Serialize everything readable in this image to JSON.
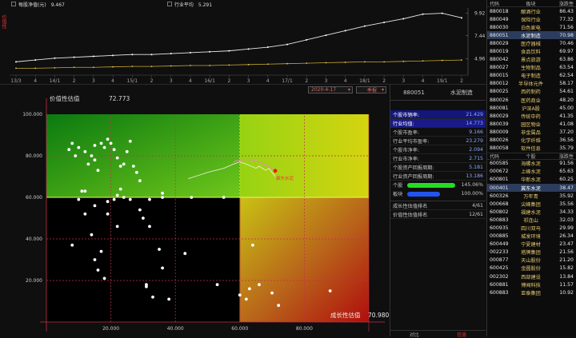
{
  "top_chart": {
    "series1_label": "每股净值(元)",
    "series1_value": "9.467",
    "series2_label": "行业平均",
    "series2_value": "5.291",
    "side_label": "价值性",
    "right_ticks": [
      "9.92",
      "7.44",
      "4.96"
    ],
    "x_labels": [
      "13/3",
      "4",
      "14/1",
      "2",
      "3",
      "4",
      "15/1",
      "2",
      "3",
      "4",
      "16/1",
      "2",
      "3",
      "4",
      "17/1",
      "2",
      "3",
      "4",
      "18/1",
      "2",
      "3",
      "4",
      "19/1",
      "2"
    ],
    "line1": [
      4.6,
      4.8,
      5.0,
      5.1,
      5.2,
      5.3,
      5.4,
      5.4,
      5.5,
      5.6,
      5.7,
      5.8,
      6.0,
      6.2,
      6.5,
      7.0,
      7.5,
      8.0,
      8.5,
      8.9,
      9.3,
      9.8,
      9.9,
      9.4
    ],
    "line2": [
      3.9,
      3.9,
      3.95,
      4.0,
      4.0,
      4.05,
      4.1,
      4.1,
      4.15,
      4.2,
      4.2,
      4.25,
      4.3,
      4.35,
      4.4,
      4.45,
      4.5,
      4.55,
      4.6,
      4.6,
      4.65,
      4.7,
      4.75,
      4.8
    ]
  },
  "controls": {
    "date": "2020-4-17",
    "period": "季报"
  },
  "scatter": {
    "y_title": "价值性估值",
    "y_title_value": "72.773",
    "x_title": "成长性估值",
    "x_title_value": "70.980",
    "y_ticks": [
      "100.000",
      "80.000",
      "60.000",
      "40.000",
      "20.000"
    ],
    "x_ticks": [
      "20.000",
      "40.000",
      "60.000",
      "80.000"
    ],
    "current_label": "冀东水泥",
    "points": [
      [
        7,
        83
      ],
      [
        8,
        86
      ],
      [
        9,
        80
      ],
      [
        10,
        84
      ],
      [
        12,
        82
      ],
      [
        13,
        76
      ],
      [
        14,
        80
      ],
      [
        15,
        78
      ],
      [
        15,
        85
      ],
      [
        16,
        73
      ],
      [
        17,
        86
      ],
      [
        18,
        84
      ],
      [
        19,
        88
      ],
      [
        20,
        86
      ],
      [
        21,
        83
      ],
      [
        22,
        79
      ],
      [
        23,
        75
      ],
      [
        24,
        76
      ],
      [
        25,
        82
      ],
      [
        26,
        87
      ],
      [
        27,
        75
      ],
      [
        28,
        72
      ],
      [
        29,
        68
      ],
      [
        23,
        64
      ],
      [
        22,
        61
      ],
      [
        24,
        60
      ],
      [
        11,
        63
      ],
      [
        12,
        63
      ],
      [
        10,
        59
      ],
      [
        12,
        52
      ],
      [
        15,
        56
      ],
      [
        19,
        58
      ],
      [
        21,
        59
      ],
      [
        19,
        52
      ],
      [
        22,
        46
      ],
      [
        26,
        59
      ],
      [
        29,
        54
      ],
      [
        30,
        50
      ],
      [
        32,
        59
      ],
      [
        36,
        60
      ],
      [
        36,
        62
      ],
      [
        45,
        60
      ],
      [
        32,
        46
      ],
      [
        35,
        35
      ],
      [
        36,
        26
      ],
      [
        31,
        18
      ],
      [
        31,
        17
      ],
      [
        33,
        12
      ],
      [
        38,
        11
      ],
      [
        43,
        33
      ],
      [
        8,
        37
      ],
      [
        14,
        42
      ],
      [
        15,
        30
      ],
      [
        16,
        25
      ],
      [
        17,
        34
      ],
      [
        18,
        21
      ],
      [
        55,
        60
      ],
      [
        53,
        18
      ],
      [
        62,
        11
      ],
      [
        63,
        16
      ],
      [
        64,
        37
      ],
      [
        66,
        18
      ],
      [
        70,
        14
      ],
      [
        72,
        8
      ],
      [
        88,
        15
      ],
      [
        60,
        13
      ]
    ],
    "trail": [
      [
        44,
        69
      ],
      [
        50,
        72
      ],
      [
        55,
        74
      ],
      [
        58,
        76
      ],
      [
        60,
        77
      ],
      [
        62,
        76
      ],
      [
        65,
        74
      ],
      [
        66,
        75
      ],
      [
        68,
        73
      ],
      [
        69,
        74
      ],
      [
        70,
        72
      ],
      [
        71,
        70
      ]
    ],
    "current_point": [
      70.98,
      72.773
    ]
  },
  "mid": {
    "header_code": "880051",
    "header_name": "水泥制造",
    "rows": [
      {
        "label": "个股市销率:",
        "value": "21.429",
        "hl": true
      },
      {
        "label": "行业均值:",
        "value": "14.773",
        "hl": true
      },
      {
        "label": "个股市盈率:",
        "value": "9.166",
        "hl": false
      },
      {
        "label": "行业平均市盈率:",
        "value": "23.279",
        "hl": false
      },
      {
        "label": "个股市净率:",
        "value": "2.094",
        "hl": false
      },
      {
        "label": "行业市净率:",
        "value": "2.715",
        "hl": false
      },
      {
        "label": "个股资产回报周期:",
        "value": "5.181",
        "hl": false
      },
      {
        "label": "行业资产回报周期:",
        "value": "13.186",
        "hl": false
      }
    ],
    "bars": [
      {
        "label": "个股",
        "value": "145.06%",
        "color": "#22dd22",
        "fill": 1.0
      },
      {
        "label": "板块",
        "value": "100.00%",
        "color": "#2255ee",
        "fill": 0.69
      }
    ],
    "rank_rows": [
      {
        "label": "成长性估值排名",
        "value": "4/61"
      },
      {
        "label": "价值性估值排名",
        "value": "12/61"
      }
    ],
    "bottom_tabs": [
      "对比",
      "信息"
    ]
  },
  "right": {
    "head": [
      "代码",
      "板块",
      "涨跌性"
    ],
    "sectors": [
      [
        "880018",
        "酿酒行业",
        "86.43"
      ],
      [
        "880049",
        "保险行业",
        "77.32"
      ],
      [
        "880030",
        "白色家电",
        "71.56"
      ],
      [
        "880051",
        "水泥制造",
        "70.98"
      ],
      [
        "880029",
        "医疗器械",
        "70.46"
      ],
      [
        "880019",
        "食品饮料",
        "69.97"
      ],
      [
        "880042",
        "景点旅游",
        "63.86"
      ],
      [
        "880027",
        "生物制品",
        "63.54"
      ],
      [
        "880015",
        "电子制造",
        "62.54"
      ],
      [
        "880012",
        "半导体元件",
        "58.17"
      ],
      [
        "880025",
        "西药制药",
        "54.61"
      ],
      [
        "880026",
        "医药商业",
        "48.20"
      ],
      [
        "880081",
        "沪深A股",
        "45.00"
      ],
      [
        "880029",
        "传统中药",
        "41.35"
      ],
      [
        "880039",
        "园区物业",
        "41.08"
      ],
      [
        "880009",
        "非金属品",
        "37.20"
      ],
      [
        "880026",
        "化学纤维",
        "36.56"
      ],
      [
        "880058",
        "软件信息",
        "35.79"
      ]
    ],
    "head2": [
      "代码",
      "个股",
      "涨跌性"
    ],
    "stocks": [
      [
        "600585",
        "海螺水泥",
        "91.56"
      ],
      [
        "000672",
        "上峰水泥",
        "65.63"
      ],
      [
        "600801",
        "华新水泥",
        "60.25"
      ],
      [
        "000401",
        "冀东水泥",
        "38.47"
      ],
      [
        "600326",
        "万年青",
        "35.92"
      ],
      [
        "000668",
        "尖峰集团",
        "35.56"
      ],
      [
        "600802",
        "福建水泥",
        "34.33"
      ],
      [
        "600883",
        "祁连山",
        "32.03"
      ],
      [
        "600935",
        "四川双马",
        "29.99"
      ],
      [
        "000885",
        "城发环境",
        "26.34"
      ],
      [
        "600449",
        "宁夏建材",
        "23.47"
      ],
      [
        "002233",
        "塔牌集团",
        "21.56"
      ],
      [
        "000877",
        "天山股份",
        "21.20"
      ],
      [
        "600425",
        "金圆股份",
        "15.82"
      ],
      [
        "002302",
        "西部建设",
        "13.84"
      ],
      [
        "600881",
        "博闻科技",
        "11.57"
      ],
      [
        "600883",
        "亚泰集团",
        "10.92"
      ]
    ],
    "selected_sector_index": 3,
    "selected_stock_index": 3
  },
  "colors": {
    "grid": "#c2314a",
    "accent": "#d33"
  }
}
